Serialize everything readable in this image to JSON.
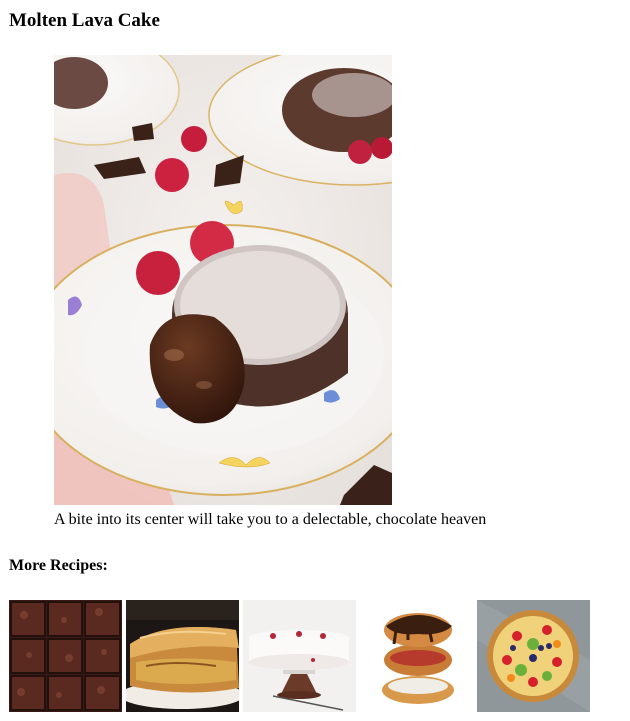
{
  "recipe": {
    "title": "Molten Lava Cake",
    "caption": "A bite into its center will take you to a delectable, chocolate heaven"
  },
  "more": {
    "heading": "More Recipes:",
    "thumbnails": [
      {
        "name": "brownies-thumbnail"
      },
      {
        "name": "apple-pie-thumbnail"
      },
      {
        "name": "layer-cake-thumbnail"
      },
      {
        "name": "donuts-thumbnail"
      },
      {
        "name": "fruit-tart-thumbnail"
      }
    ]
  }
}
